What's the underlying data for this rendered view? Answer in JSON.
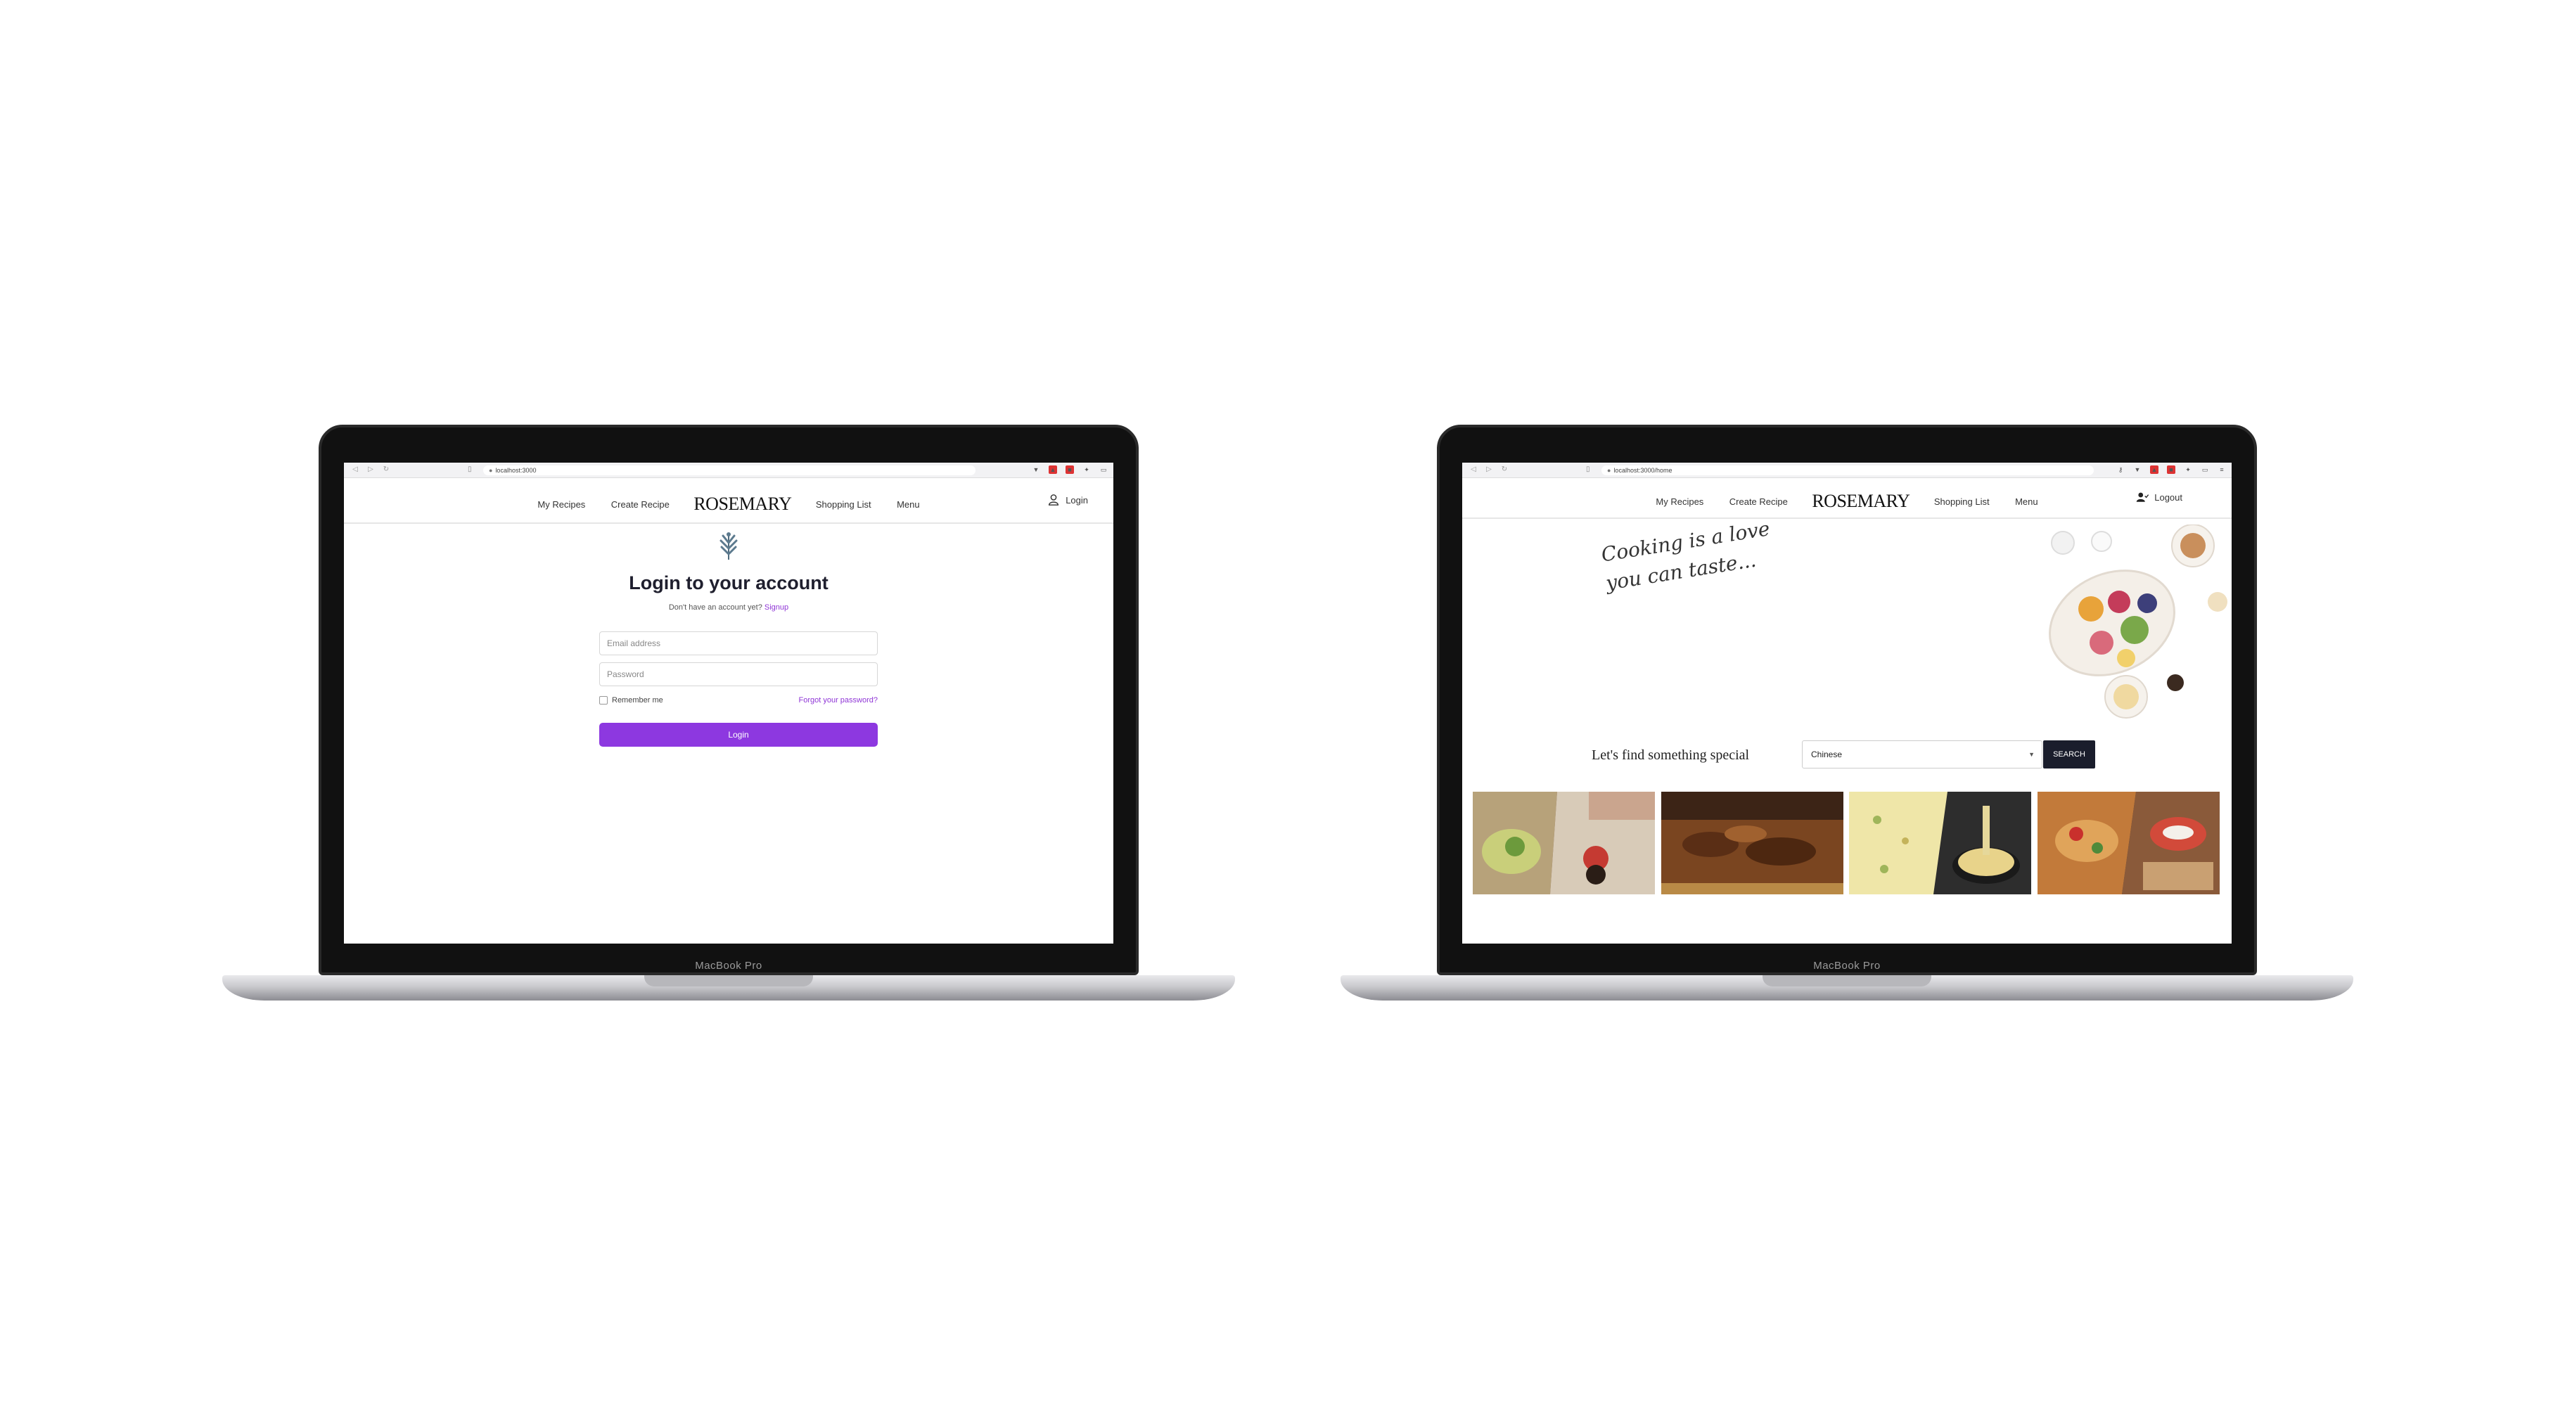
{
  "device_label": "MacBook Pro",
  "nav": {
    "my_recipes": "My Recipes",
    "create_recipe": "Create Recipe",
    "brand": "ROSEMARY",
    "shopping_list": "Shopping List",
    "menu": "Menu"
  },
  "login_screen": {
    "url": "localhost:3000",
    "account_label": "Login",
    "title": "Login to your account",
    "signup_prompt": "Don't have an account yet?",
    "signup_link": "Signup",
    "email_placeholder": "Email address",
    "password_placeholder": "Password",
    "remember_me": "Remember me",
    "forgot_password": "Forgot your password?",
    "login_button": "Login"
  },
  "home_screen": {
    "url": "localhost:3000/home",
    "account_label": "Logout",
    "hero_line1": "Cooking is a love",
    "hero_line2": "you can taste...",
    "search_heading": "Let's find something special",
    "search_selected": "Chinese",
    "search_button": "SEARCH"
  },
  "colors": {
    "accent_purple": "#8d38e0",
    "search_button_bg": "#1a1d2c"
  }
}
